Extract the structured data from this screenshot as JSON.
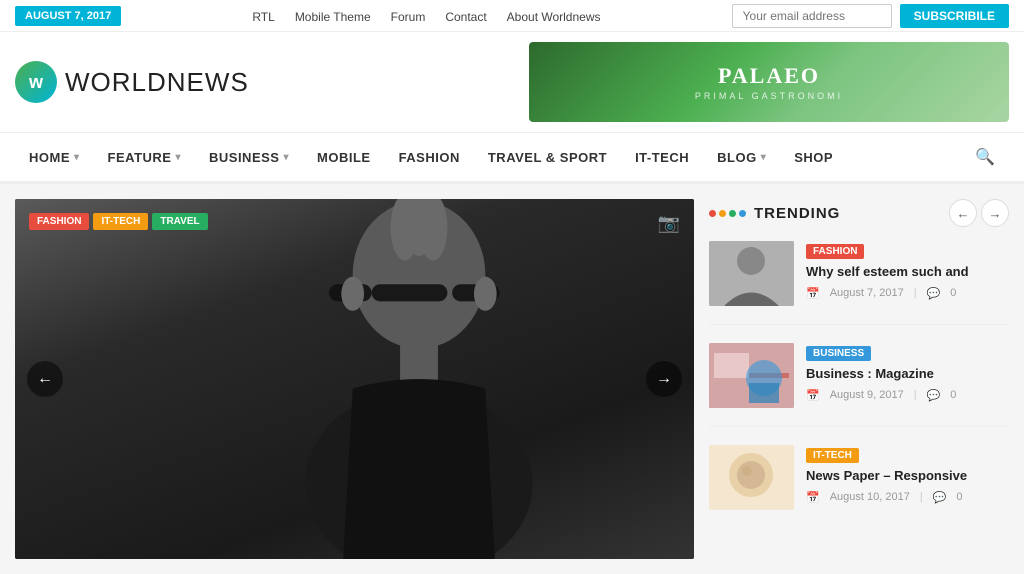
{
  "topbar": {
    "date": "AUGUST 7, 2017",
    "nav": [
      "RTL",
      "Mobile Theme",
      "Forum",
      "Contact",
      "About Worldnews"
    ],
    "email_placeholder": "Your email address",
    "subscribe_label": "SUBSCRIBILE"
  },
  "logo": {
    "icon_letter": "w",
    "brand_bold": "WORLD",
    "brand_light": "NEWS"
  },
  "banner": {
    "title": "PALAEO",
    "subtitle": "PRIMAL GASTRONOMI"
  },
  "nav": {
    "items": [
      {
        "label": "HOME",
        "has_dropdown": true
      },
      {
        "label": "FEATURE",
        "has_dropdown": true
      },
      {
        "label": "BUSINESS",
        "has_dropdown": true
      },
      {
        "label": "MOBILE",
        "has_dropdown": false
      },
      {
        "label": "FASHION",
        "has_dropdown": false
      },
      {
        "label": "TRAVEL & SPORT",
        "has_dropdown": false
      },
      {
        "label": "IT-TECH",
        "has_dropdown": false
      },
      {
        "label": "BLOG",
        "has_dropdown": true
      },
      {
        "label": "SHOP",
        "has_dropdown": false
      }
    ]
  },
  "slider": {
    "tags": [
      "FASHION",
      "IT-TECH",
      "TRAVEL"
    ],
    "prev_icon": "←",
    "next_icon": "→"
  },
  "trending": {
    "title": "TRENDING",
    "prev_icon": "←",
    "next_icon": "→",
    "items": [
      {
        "badge": "FASHION",
        "badge_type": "fashion",
        "headline": "Why self esteem such and",
        "date": "August 7, 2017",
        "comments": "0"
      },
      {
        "badge": "BUSINESS",
        "badge_type": "business",
        "headline": "Business : Magazine",
        "date": "August 9, 2017",
        "comments": "0"
      },
      {
        "badge": "IT-TECH",
        "badge_type": "ittech",
        "headline": "News Paper – Responsive",
        "date": "August 10, 2017",
        "comments": "0"
      }
    ]
  }
}
